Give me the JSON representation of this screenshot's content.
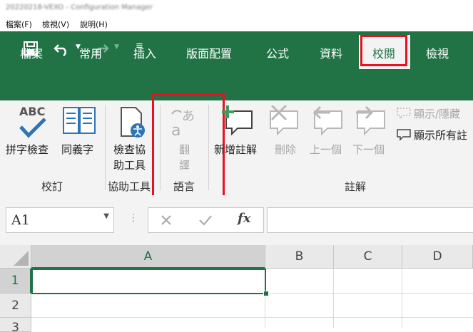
{
  "window": {
    "title": "20220218-VEXO - Configuration Manager"
  },
  "menubar": {
    "items": [
      {
        "label": "檔案(F)"
      },
      {
        "label": "檢視(V)"
      },
      {
        "label": "說明(H)"
      }
    ]
  },
  "ribbon": {
    "tabs": [
      {
        "label": "檔案"
      },
      {
        "label": "常用"
      },
      {
        "label": "插入"
      },
      {
        "label": "版面配置"
      },
      {
        "label": "公式"
      },
      {
        "label": "資料"
      },
      {
        "label": "校閱",
        "selected": true
      },
      {
        "label": "檢視"
      }
    ],
    "buttons": {
      "spelling": "拼字檢查",
      "thesaurus": "同義字",
      "accessibility_line1": "檢查協",
      "accessibility_line2": "助工具",
      "translate_line1": "翻",
      "translate_line2": "譯",
      "new_comment": "新增註解",
      "delete": "刪除",
      "previous": "上一個",
      "next": "下一個",
      "show_hide": "顯示/隱藏",
      "show_all": "顯示所有註"
    },
    "groups": {
      "proofing": "校訂",
      "accessibility": "協助工具",
      "language": "語言",
      "comments": "註解"
    },
    "icon_text": {
      "abc": "ABC"
    }
  },
  "formula_bar": {
    "name_box": "A1",
    "fx": "fx"
  },
  "sheet": {
    "columns": [
      "A",
      "B",
      "C",
      "D"
    ],
    "rows": [
      "1",
      "2",
      "3"
    ],
    "selected_cell": "A1"
  },
  "colors": {
    "accent": "#217346",
    "highlight": "#e81123"
  }
}
